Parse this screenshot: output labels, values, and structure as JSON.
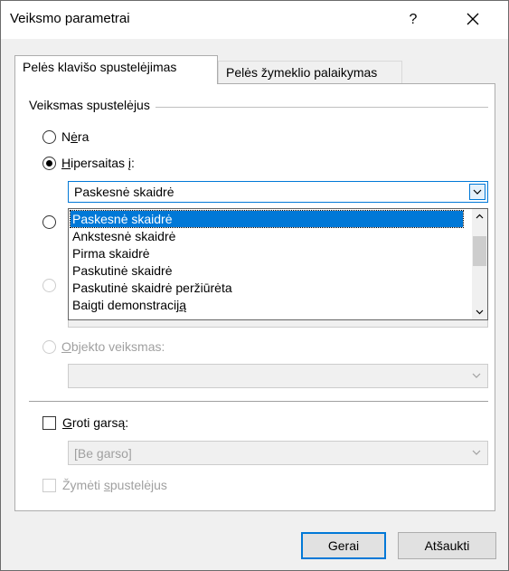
{
  "dialog": {
    "title": "Veiksmo parametrai",
    "help": "?",
    "close_icon": "close-icon"
  },
  "tabs": [
    {
      "label": "Pelės klavišo spustelėjimas",
      "selected": true
    },
    {
      "label": "Pelės žymeklio palaikymas",
      "selected": false
    }
  ],
  "group": {
    "label": "Veiksmas spustelėjus"
  },
  "options": {
    "none": {
      "prefix": "N",
      "underline": "ė",
      "suffix": "ra",
      "selected": false
    },
    "hyperlink": {
      "prefix": "",
      "underline": "H",
      "suffix": "ipersaitas į:",
      "selected": true
    },
    "hyperlink_value": "Paskesnė skaidrė",
    "object_action": {
      "prefix": "",
      "underline": "O",
      "suffix": "bjekto veiksmas:",
      "selected": false
    }
  },
  "dropdown": {
    "items": [
      "Paskesnė skaidrė",
      "Ankstesnė skaidrė",
      "Pirma skaidrė",
      "Paskutinė skaidrė",
      "Paskutinė skaidrė peržiūrėta",
      "Baigti demonstraciją"
    ],
    "selected_index": 0,
    "last_item_prefix": "Baigti demonstracij",
    "last_item_underline": "ą"
  },
  "sound": {
    "prefix": "",
    "underline": "G",
    "suffix": "roti garsą:",
    "checked": false,
    "value": "[Be garso]"
  },
  "highlight": {
    "label_prefix": "Žymėti ",
    "label_underline": "s",
    "label_suffix": "pustelėjus",
    "checked": false
  },
  "buttons": {
    "ok": "Gerai",
    "cancel": "Atšaukti"
  },
  "colors": {
    "accent": "#0078d7",
    "dialog_bg": "#f0f0f0",
    "disabled_text": "#a0a0a0"
  }
}
